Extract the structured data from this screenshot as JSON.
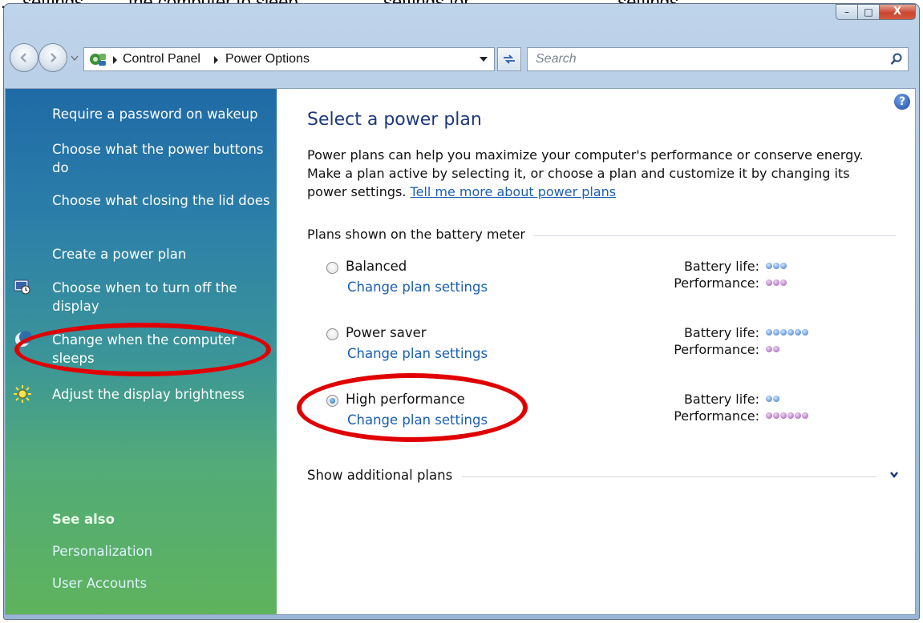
{
  "caption": "… settings …… the computer to sleep … ……… settings for … ……… …… … settings",
  "window": {
    "min_glyph": "–",
    "max_glyph": "□",
    "close_glyph": "X"
  },
  "address_bar": {
    "crumbs": [
      "Control Panel",
      "Power Options"
    ],
    "search_placeholder": "Search"
  },
  "sidebar": {
    "links": [
      "Require a password on wakeup",
      "Choose what the power buttons do",
      "Choose what closing the lid does",
      "Create a power plan",
      "Choose when to turn off the display",
      "Change when the computer sleeps",
      "Adjust the display brightness"
    ],
    "see_also_label": "See also",
    "see_also": [
      "Personalization",
      "User Accounts"
    ]
  },
  "main": {
    "help_glyph": "?",
    "title": "Select a power plan",
    "intro": "Power plans can help you maximize your computer's performance or conserve energy. Make a plan active by selecting it, or choose a plan and customize it by changing its power settings.",
    "intro_link": "Tell me more about power plans",
    "group_label": "Plans shown on the battery meter",
    "battery_label": "Battery life:",
    "performance_label": "Performance:",
    "plans": [
      {
        "name": "Balanced",
        "link": "Change plan settings",
        "selected": false,
        "battery_dots": 3,
        "performance_dots": 3
      },
      {
        "name": "Power saver",
        "link": "Change plan settings",
        "selected": false,
        "battery_dots": 6,
        "performance_dots": 2
      },
      {
        "name": "High performance",
        "link": "Change plan settings",
        "selected": true,
        "battery_dots": 2,
        "performance_dots": 6
      }
    ],
    "more_plans": "Show additional plans"
  },
  "colors": {
    "accent_link": "#1a5fb4",
    "annotation_red": "#e00000",
    "battery_dot": "#3b73c9",
    "performance_dot": "#9b54b0"
  }
}
